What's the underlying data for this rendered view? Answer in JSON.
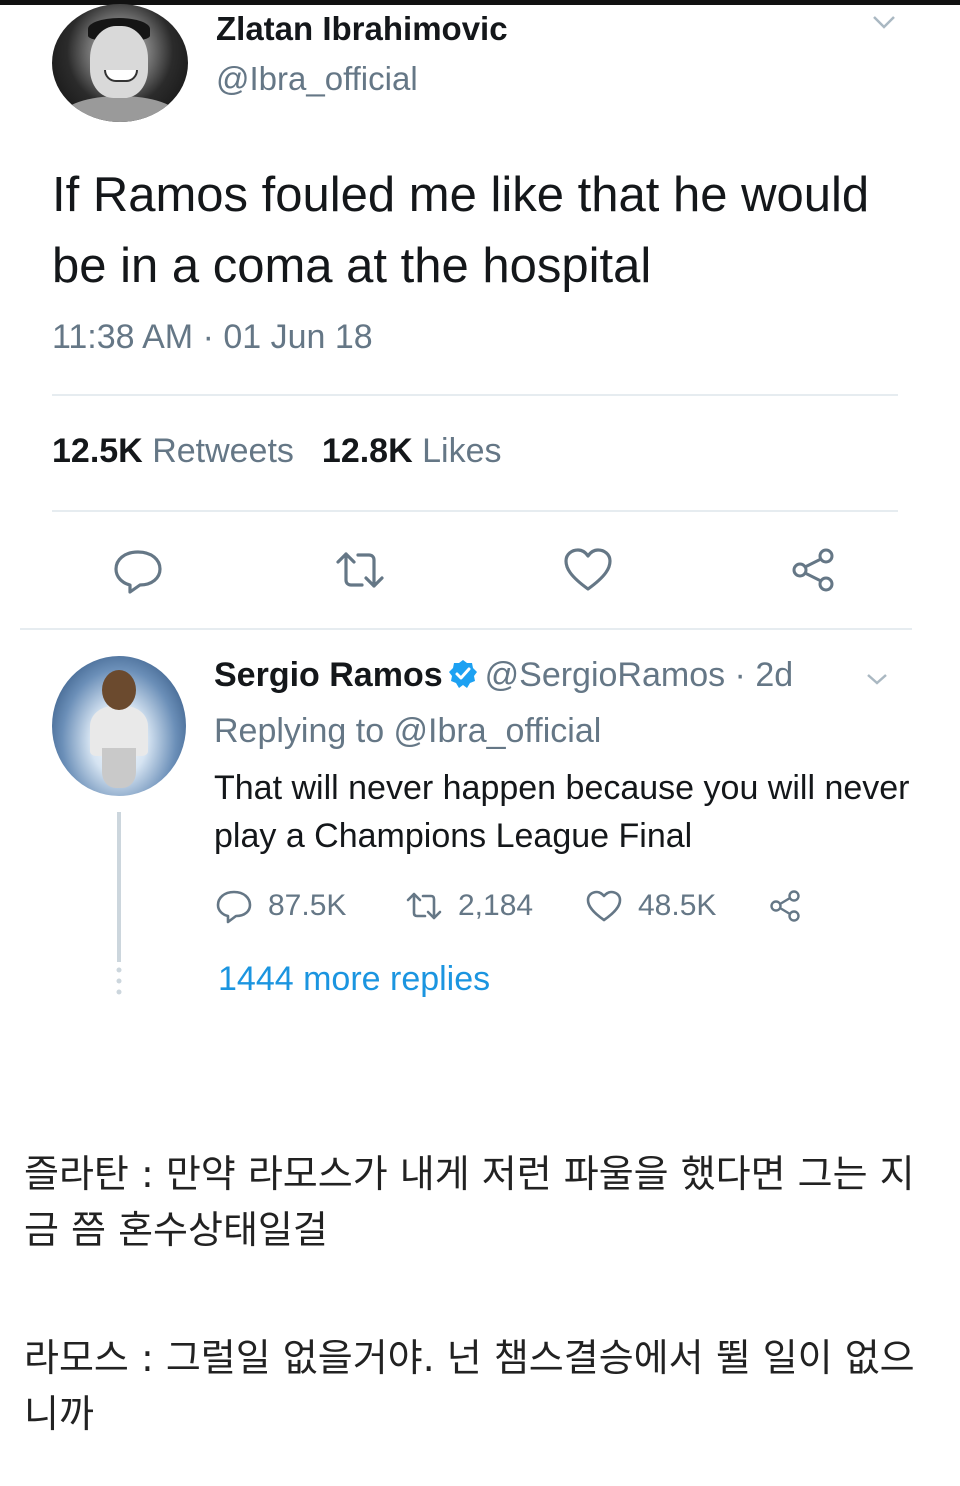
{
  "tweet": {
    "author_name": "Zlatan Ibrahimovic",
    "handle": "@Ibra_official",
    "text": "If Ramos fouled me like that he would be in a coma at the hospital",
    "timestamp": "11:38 AM · 01 Jun 18",
    "retweets_count": "12.5K",
    "retweets_label": "Retweets",
    "likes_count": "12.8K",
    "likes_label": "Likes",
    "actions": [
      "reply-icon",
      "retweet-icon",
      "like-icon",
      "share-icon"
    ]
  },
  "reply": {
    "author_name": "Sergio Ramos",
    "handle_time": "@SergioRamos · 2d",
    "replying_to": "Replying to @Ibra_official",
    "text": "That will never happen because you will never play a Champions League Final",
    "replies": "87.5K",
    "retweets": "2,184",
    "likes": "48.5K",
    "more_replies": "1444 more replies"
  },
  "caption": {
    "line1": "즐라탄 : 만약 라모스가 내게 저런 파울을 했다면 그는 지금 쯤 혼수상태일걸",
    "line2": "라모스 : 그럴일 없을거야. 넌 챔스결승에서 뛸 일이 없으니까"
  },
  "colors": {
    "text": "#14171a",
    "muted": "#657786",
    "link": "#1b95e0",
    "verified": "#1da1f2",
    "divider": "#e6ecf0"
  }
}
